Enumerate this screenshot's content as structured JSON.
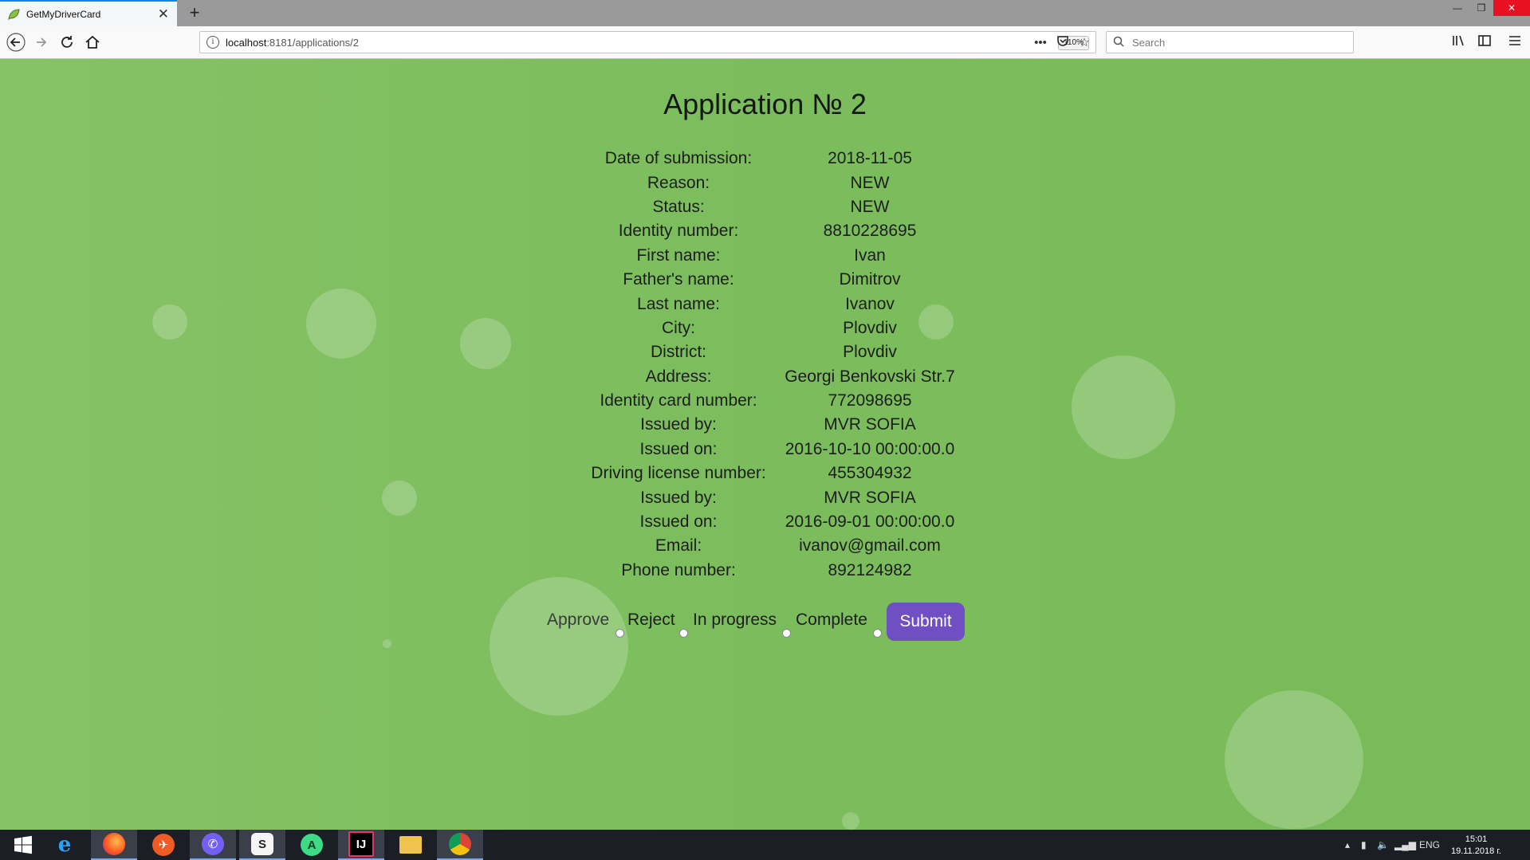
{
  "browser": {
    "tab_title": "GetMyDriverCard",
    "tab_close": "✕",
    "new_tab": "+",
    "url_host": "localhost",
    "url_path": ":8181/applications/2",
    "zoom": "110%",
    "search_placeholder": "Search",
    "win_min": "—",
    "win_restore": "❐",
    "win_close": "✕"
  },
  "page": {
    "title": "Application № 2",
    "fields": [
      {
        "label": "Date of submission:",
        "value": "2018-11-05"
      },
      {
        "label": "Reason:",
        "value": "NEW"
      },
      {
        "label": "Status:",
        "value": "NEW"
      },
      {
        "label": "Identity number:",
        "value": "8810228695"
      },
      {
        "label": "First name:",
        "value": "Ivan"
      },
      {
        "label": "Father's name:",
        "value": "Dimitrov"
      },
      {
        "label": "Last name:",
        "value": "Ivanov"
      },
      {
        "label": "City:",
        "value": "Plovdiv"
      },
      {
        "label": "District:",
        "value": "Plovdiv"
      },
      {
        "label": "Address:",
        "value": "Georgi Benkovski Str.7"
      },
      {
        "label": "Identity card number:",
        "value": "772098695"
      },
      {
        "label": "Issued by:",
        "value": "MVR SOFIA"
      },
      {
        "label": "Issued on:",
        "value": "2016-10-10 00:00:00.0"
      },
      {
        "label": "Driving license number:",
        "value": "455304932"
      },
      {
        "label": "Issued by:",
        "value": "MVR SOFIA"
      },
      {
        "label": "Issued on:",
        "value": "2016-09-01 00:00:00.0"
      },
      {
        "label": "Email:",
        "value": "ivanov@gmail.com"
      },
      {
        "label": "Phone number:",
        "value": "892124982"
      }
    ],
    "options": [
      "Approve",
      "Reject",
      "In progress",
      "Complete"
    ],
    "submit_label": "Submit"
  },
  "taskbar": {
    "apps": [
      "windows-start",
      "internet-explorer",
      "firefox",
      "postman",
      "viber",
      "sublime",
      "android-studio",
      "intellij",
      "file-explorer",
      "chrome"
    ],
    "language": "ENG",
    "time": "15:01",
    "date": "19.11.2018 г."
  },
  "colors": {
    "background": "#7dbd5f",
    "submit": "#6f4fc2"
  }
}
